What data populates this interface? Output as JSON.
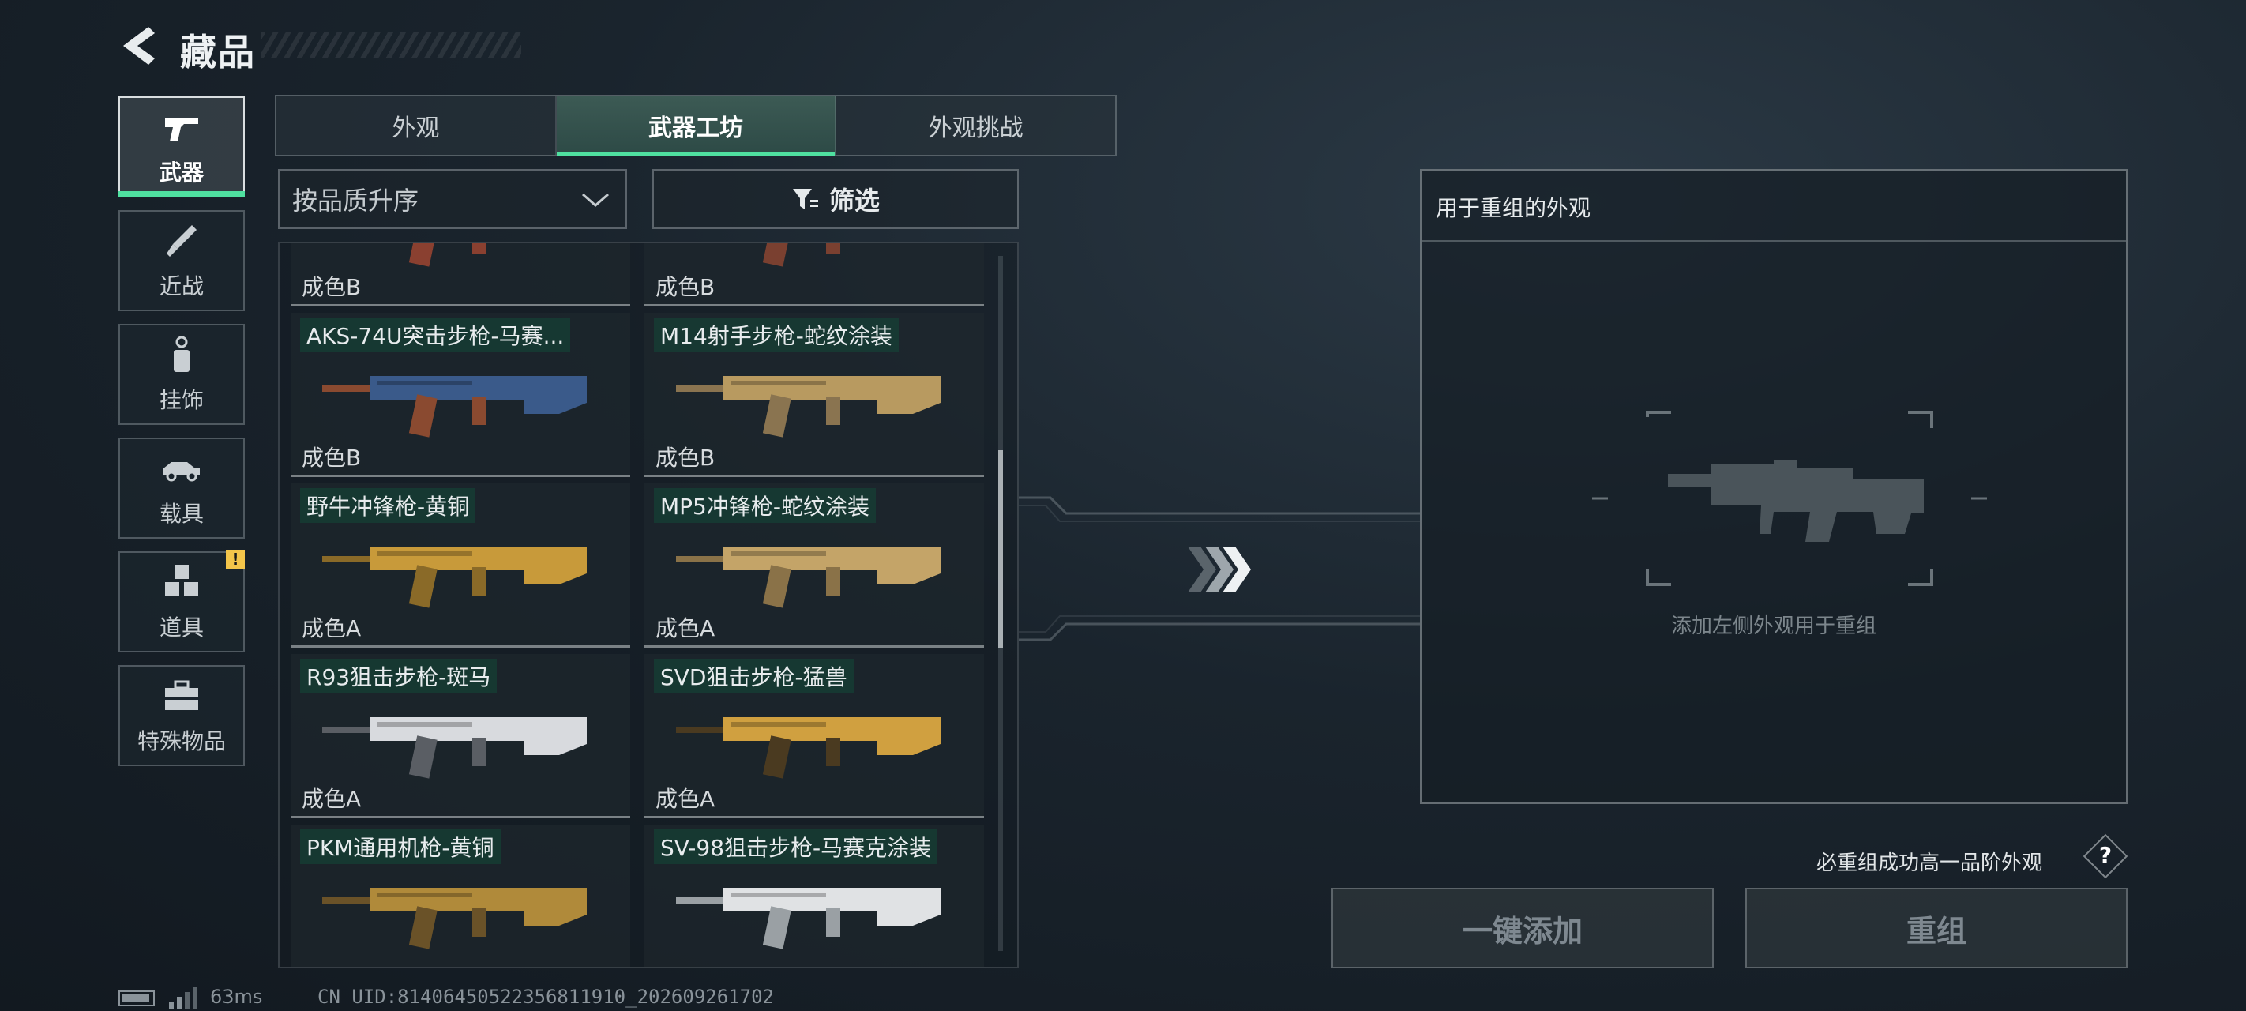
{
  "header": {
    "title": "藏品",
    "back_icon": "back-arrow-icon"
  },
  "categories": [
    {
      "label": "武器",
      "icon": "pistol-icon",
      "active": true
    },
    {
      "label": "近战",
      "icon": "knife-icon",
      "active": false
    },
    {
      "label": "挂饰",
      "icon": "charm-icon",
      "active": false
    },
    {
      "label": "载具",
      "icon": "vehicle-icon",
      "active": false
    },
    {
      "label": "道具",
      "icon": "items-icon",
      "active": false,
      "badge": "!"
    },
    {
      "label": "特殊物品",
      "icon": "toolbox-icon",
      "active": false
    }
  ],
  "tabs": [
    {
      "label": "外观",
      "active": false
    },
    {
      "label": "武器工坊",
      "active": true
    },
    {
      "label": "外观挑战",
      "active": false
    }
  ],
  "sort": {
    "label": "按品质升序"
  },
  "filter": {
    "label": "筛选"
  },
  "items": [
    {
      "name": "",
      "grade": "成色B",
      "colors": [
        "#5a6a80",
        "#8a4030"
      ]
    },
    {
      "name": "",
      "grade": "成色B",
      "colors": [
        "#a05030",
        "#7a4030"
      ]
    },
    {
      "name": "AKS-74U突击步枪-马赛...",
      "grade": "成色B",
      "colors": [
        "#3a5a8a",
        "#8a4a30"
      ]
    },
    {
      "name": "M14射手步枪-蛇纹涂装",
      "grade": "成色B",
      "colors": [
        "#b89a60",
        "#8a7450"
      ]
    },
    {
      "name": "野牛冲锋枪-黄铜",
      "grade": "成色A",
      "colors": [
        "#c89a3a",
        "#8a6a28"
      ]
    },
    {
      "name": "MP5冲锋枪-蛇纹涂装",
      "grade": "成色A",
      "colors": [
        "#c4a468",
        "#8a7248"
      ]
    },
    {
      "name": "R93狙击步枪-斑马",
      "grade": "成色A",
      "colors": [
        "#d8dade",
        "#5a5e64"
      ]
    },
    {
      "name": "SVD狙击步枪-猛兽",
      "grade": "成色A",
      "colors": [
        "#d0a040",
        "#4a3a20"
      ]
    },
    {
      "name": "PKM通用机枪-黄铜",
      "grade": "",
      "colors": [
        "#b08a3a",
        "#6a5228"
      ]
    },
    {
      "name": "SV-98狙击步枪-马赛克涂装",
      "grade": "",
      "colors": [
        "#e0e2e4",
        "#9aa0a4"
      ]
    }
  ],
  "recombine": {
    "header": "用于重组的外观",
    "hint": "添加左侧外观用于重组",
    "note": "必重组成功高一品阶外观",
    "help": "?",
    "add_button": "一键添加",
    "recombine_button": "重组"
  },
  "status": {
    "ping": "63ms",
    "uid": "CN UID:8140645052235681191​0_202609261702"
  }
}
